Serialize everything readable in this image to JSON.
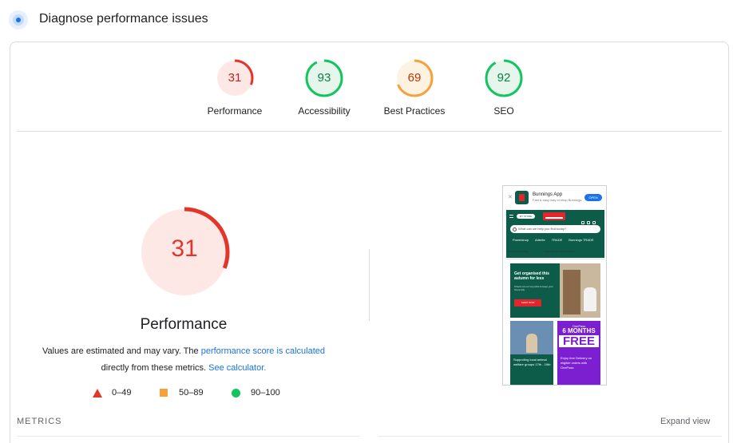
{
  "header": {
    "title": "Diagnose performance issues",
    "icon": "lighthouse-icon"
  },
  "categories": [
    {
      "label": "Performance",
      "score": "31",
      "value": 31,
      "color": "#e2362b",
      "bg": "#fde8e6"
    },
    {
      "label": "Accessibility",
      "score": "93",
      "value": 93,
      "color": "#13c55f",
      "bg": "#e6f6ec"
    },
    {
      "label": "Best Practices",
      "score": "69",
      "value": 69,
      "color": "#f6a23c",
      "bg": "#fef3e2"
    },
    {
      "label": "SEO",
      "score": "92",
      "value": 92,
      "color": "#13c55f",
      "bg": "#e6f6ec"
    }
  ],
  "main": {
    "score": "31",
    "value": 31,
    "title": "Performance",
    "desc_prefix": "Values are estimated and may vary. The ",
    "desc_link1": "performance score is calculated",
    "desc_middle": " directly from these metrics. ",
    "desc_link2": "See calculator."
  },
  "legend": [
    {
      "shape": "triangle",
      "label": "0–49",
      "color": "#e2362b"
    },
    {
      "shape": "square",
      "label": "50–89",
      "color": "#f6a23c"
    },
    {
      "shape": "circle",
      "label": "90–100",
      "color": "#13c55f"
    }
  ],
  "metrics": {
    "label": "METRICS",
    "expand_label": "Expand view"
  },
  "screenshot": {
    "app_name": "Bunnings App",
    "app_sub": "Fast & easy way to shop Bunnings",
    "open_label": "OPEN",
    "store_label": "MY STORE",
    "search_placeholder": "What can we help you find today?",
    "brands": [
      "Powershop",
      "Adbrite",
      "TRADE",
      "Bunnings TRADE"
    ],
    "promo_left": "Lowest Price Policy",
    "promo_right": "Free Delivery with OnePass",
    "card1_title": "Get organised this autumn for less",
    "card1_sub": "Check out our top picks to keep your home tidy",
    "card1_button": "SHOP NOW",
    "card2_text": "Supporting local animal welfare groups 17th - 19th",
    "card3_top": "OnePass",
    "card3_big": "6 MONTHS",
    "card3_free": "FREE",
    "card3_text": "Enjoy free Delivery on eligible orders with OnePass"
  }
}
